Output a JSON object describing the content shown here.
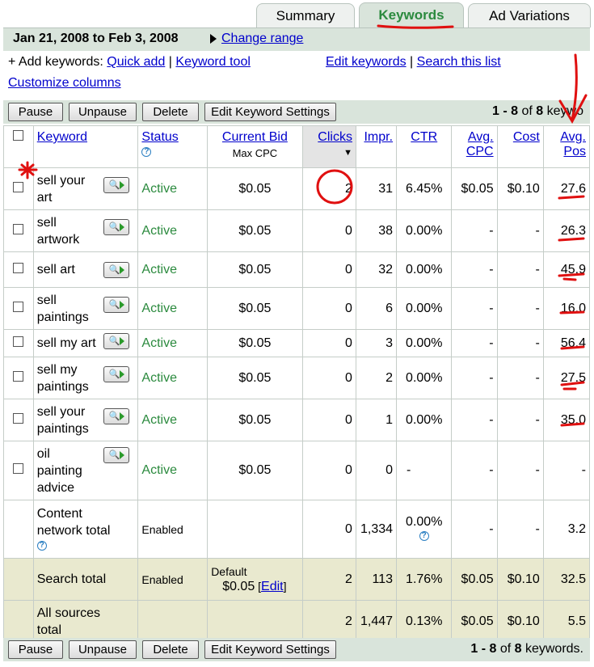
{
  "tabs": [
    "Summary",
    "Keywords",
    "Ad Variations"
  ],
  "header": {
    "date_range": "Jan 21, 2008 to Feb 3, 2008",
    "change_range": "Change range"
  },
  "add": {
    "prefix": "+ Add keywords:",
    "quick_add": "Quick add",
    "sep1": "|",
    "keyword_tool": "Keyword tool",
    "edit_keywords": "Edit keywords",
    "sep2": "|",
    "search_list": "Search this list",
    "customize": "Customize columns"
  },
  "toolbar": {
    "pause": "Pause",
    "unpause": "Unpause",
    "delete": "Delete",
    "edit_settings": "Edit Keyword Settings",
    "pager_top": "1 - 8 of 8 keywo",
    "pager_bottom": "1 - 8 of 8 keywords."
  },
  "columns": {
    "keyword": "Keyword",
    "status": "Status",
    "bid": "Current Bid",
    "bid_sub": "Max CPC",
    "clicks": "Clicks",
    "impr": "Impr.",
    "ctr": "CTR",
    "cpc1": "Avg.",
    "cpc2": "CPC",
    "cost": "Cost",
    "pos1": "Avg.",
    "pos2": "Pos"
  },
  "rows": [
    {
      "keyword": "sell your art",
      "status": "Active",
      "bid": "$0.05",
      "clicks": "2",
      "impr": "31",
      "ctr": "6.45%",
      "cpc": "$0.05",
      "cost": "$0.10",
      "pos": "27.6"
    },
    {
      "keyword": "sell artwork",
      "status": "Active",
      "bid": "$0.05",
      "clicks": "0",
      "impr": "38",
      "ctr": "0.00%",
      "cpc": "-",
      "cost": "-",
      "pos": "26.3"
    },
    {
      "keyword": "sell art",
      "status": "Active",
      "bid": "$0.05",
      "clicks": "0",
      "impr": "32",
      "ctr": "0.00%",
      "cpc": "-",
      "cost": "-",
      "pos": "45.9"
    },
    {
      "keyword": "sell paintings",
      "status": "Active",
      "bid": "$0.05",
      "clicks": "0",
      "impr": "6",
      "ctr": "0.00%",
      "cpc": "-",
      "cost": "-",
      "pos": "16.0"
    },
    {
      "keyword": "sell my art",
      "status": "Active",
      "bid": "$0.05",
      "clicks": "0",
      "impr": "3",
      "ctr": "0.00%",
      "cpc": "-",
      "cost": "-",
      "pos": "56.4"
    },
    {
      "keyword": "sell my paintings",
      "status": "Active",
      "bid": "$0.05",
      "clicks": "0",
      "impr": "2",
      "ctr": "0.00%",
      "cpc": "-",
      "cost": "-",
      "pos": "27.5"
    },
    {
      "keyword": "sell your paintings",
      "status": "Active",
      "bid": "$0.05",
      "clicks": "0",
      "impr": "1",
      "ctr": "0.00%",
      "cpc": "-",
      "cost": "-",
      "pos": "35.0"
    },
    {
      "keyword": "oil painting advice",
      "status": "Active",
      "bid": "$0.05",
      "clicks": "0",
      "impr": "0",
      "ctr": "-",
      "cpc": "-",
      "cost": "-",
      "pos": "-"
    }
  ],
  "content_total": {
    "label": "Content network total",
    "status": "Enabled",
    "clicks": "0",
    "impr": "1,334",
    "ctr": "0.00%",
    "cpc": "-",
    "cost": "-",
    "pos": "3.2"
  },
  "search_total": {
    "label": "Search total",
    "status": "Enabled",
    "bid_label": "Default",
    "bid": "$0.05",
    "edit": "Edit",
    "clicks": "2",
    "impr": "113",
    "ctr": "1.76%",
    "cpc": "$0.05",
    "cost": "$0.10",
    "pos": "32.5"
  },
  "all_total": {
    "label": "All sources total",
    "clicks": "2",
    "impr": "1,447",
    "ctr": "0.13%",
    "cpc": "$0.05",
    "cost": "$0.10",
    "pos": "5.5"
  },
  "annotation_color": "#e01010"
}
